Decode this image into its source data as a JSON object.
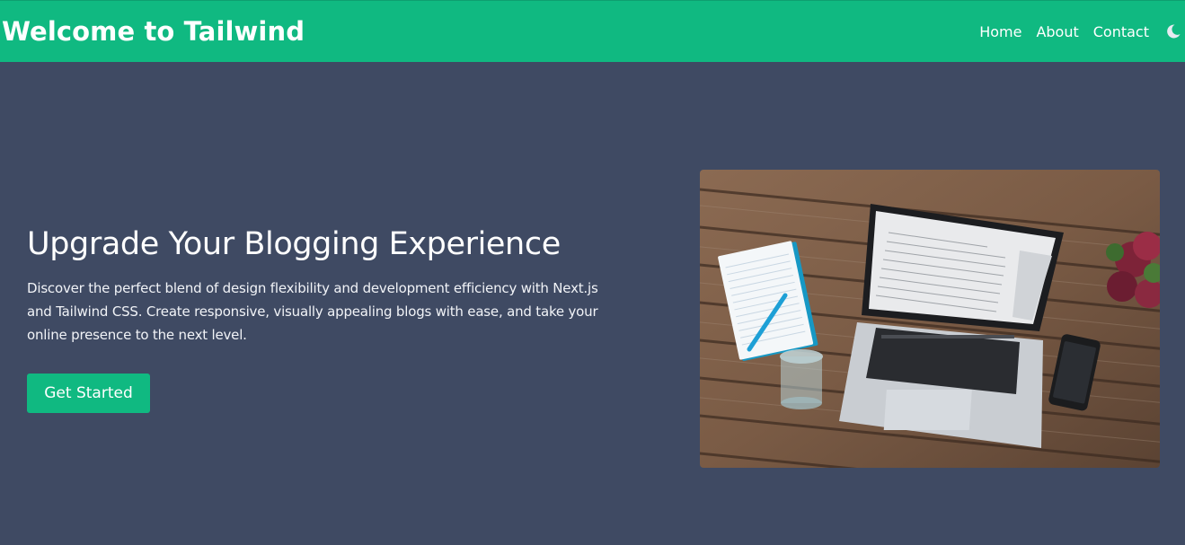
{
  "navbar": {
    "brand": "Welcome to Tailwind",
    "links": [
      {
        "label": "Home"
      },
      {
        "label": "About"
      },
      {
        "label": "Contact"
      }
    ],
    "theme_icon": "moon-icon"
  },
  "hero": {
    "title": "Upgrade Your Blogging Experience",
    "description": "Discover the perfect blend of design flexibility and development efficiency with Next.js and Tailwind CSS. Create responsive, visually appealing blogs with ease, and take your online presence to the next level.",
    "cta_label": "Get Started",
    "image_alt": "laptop-on-wooden-desk"
  },
  "colors": {
    "accent": "#10b981",
    "background": "#3f4a63",
    "text": "#ffffff"
  }
}
